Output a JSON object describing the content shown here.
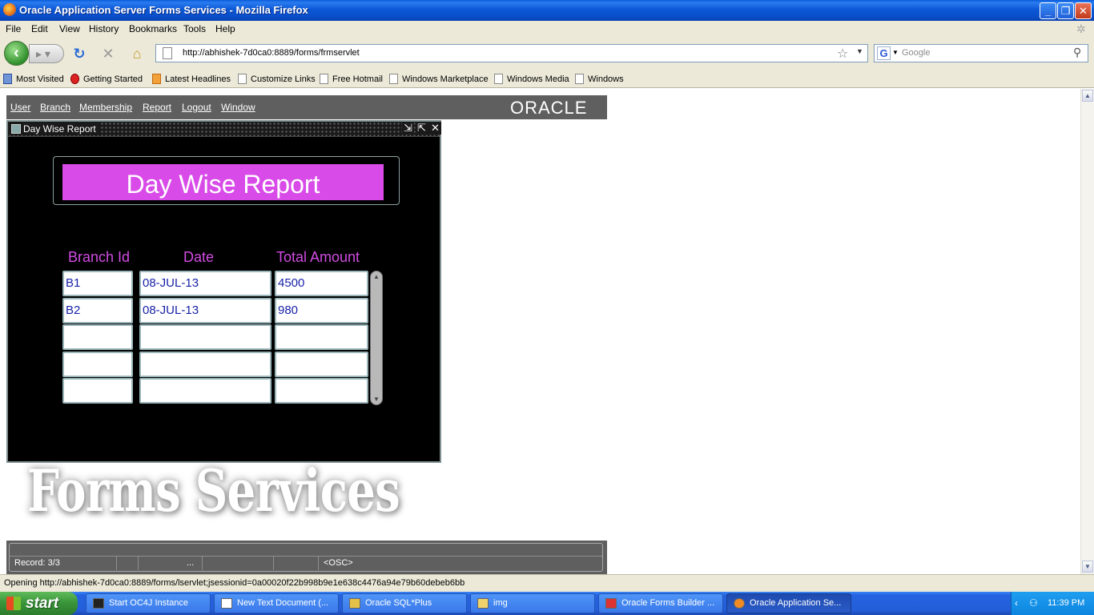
{
  "window": {
    "title": "Oracle Application Server Forms Services - Mozilla Firefox"
  },
  "menu": [
    "File",
    "Edit",
    "View",
    "History",
    "Bookmarks",
    "Tools",
    "Help"
  ],
  "nav": {
    "url": "http://abhishek-7d0ca0:8889/forms/frmservlet",
    "search_placeholder": "Google"
  },
  "bookmarks": [
    "Most Visited",
    "Getting Started",
    "Latest Headlines",
    "Customize Links",
    "Free Hotmail",
    "Windows Marketplace",
    "Windows Media",
    "Windows"
  ],
  "app": {
    "menu": [
      "User",
      "Branch",
      "Membership",
      "Report",
      "Logout",
      "Window"
    ],
    "logo": "ORACLE",
    "form_window_title": "Day Wise Report",
    "banner": "Day Wise Report",
    "columns": [
      "Branch Id",
      "Date",
      "Total Amount"
    ],
    "rows": [
      {
        "branch_id": "B1",
        "date": "08-JUL-13",
        "total": "4500"
      },
      {
        "branch_id": "B2",
        "date": "08-JUL-13",
        "total": "980"
      },
      {
        "branch_id": "",
        "date": "",
        "total": ""
      },
      {
        "branch_id": "",
        "date": "",
        "total": ""
      },
      {
        "branch_id": "",
        "date": "",
        "total": ""
      }
    ],
    "watermark": "Forms Services",
    "status": {
      "record": "Record: 3/3",
      "ellipsis": "...",
      "osc": "<OSC>"
    }
  },
  "browser_status": "Opening http://abhishek-7d0ca0:8889/forms/lservlet;jsessionid=0a00020f22b998b9e1e638c4476a94e79b60debeb6bb",
  "taskbar": {
    "start": "start",
    "tasks": [
      "Start OC4J Instance",
      "New Text Document (...",
      "Oracle SQL*Plus",
      "img",
      "Oracle Forms Builder ...",
      "Oracle Application Se..."
    ],
    "clock": "11:39 PM"
  }
}
